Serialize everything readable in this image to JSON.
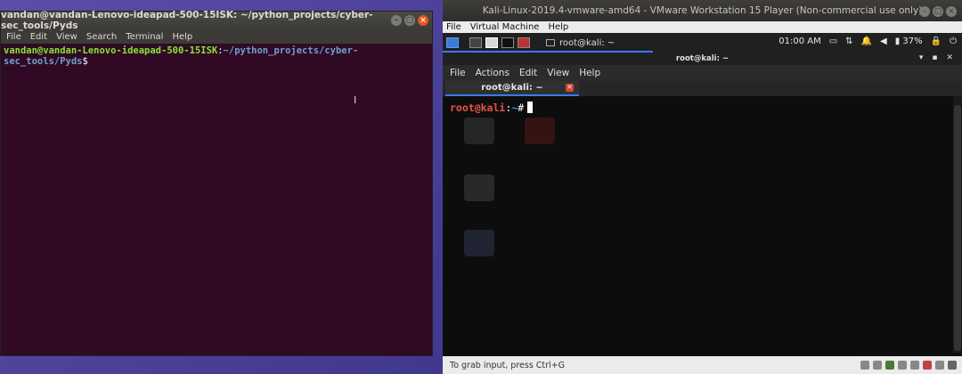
{
  "left_terminal": {
    "title": "vandan@vandan-Lenovo-ideapad-500-15ISK: ~/python_projects/cyber-sec_tools/Pyds",
    "menu": [
      "File",
      "Edit",
      "View",
      "Search",
      "Terminal",
      "Help"
    ],
    "prompt_user": "vandan@vandan-Lenovo-ideapad-500-15ISK",
    "prompt_sep": ":",
    "prompt_path": "~/python_projects/cyber-sec_tools/Pyds",
    "prompt_symbol": "$"
  },
  "vmware": {
    "title": "Kali-Linux-2019.4-vmware-amd64 - VMware Workstation 15 Player (Non-commercial use only)",
    "menu": [
      "File",
      "Virtual Machine",
      "Help"
    ],
    "status_text": "To grab input, press Ctrl+G"
  },
  "kali_panel": {
    "task_label": "root@kali: ~",
    "time": "01:00 AM",
    "battery": "37%"
  },
  "kali_terminal": {
    "title": "root@kali: ~",
    "menu": [
      "File",
      "Actions",
      "Edit",
      "View",
      "Help"
    ],
    "tab_label": "root@kali: ~",
    "prompt_user": "root@kali",
    "prompt_sep": ":",
    "prompt_path": "~",
    "prompt_symbol": "#"
  },
  "colors": {
    "ubuntu_terminal_bg": "#300a24",
    "kali_accent": "#367bf0",
    "kali_prompt_red": "#e8524a"
  }
}
